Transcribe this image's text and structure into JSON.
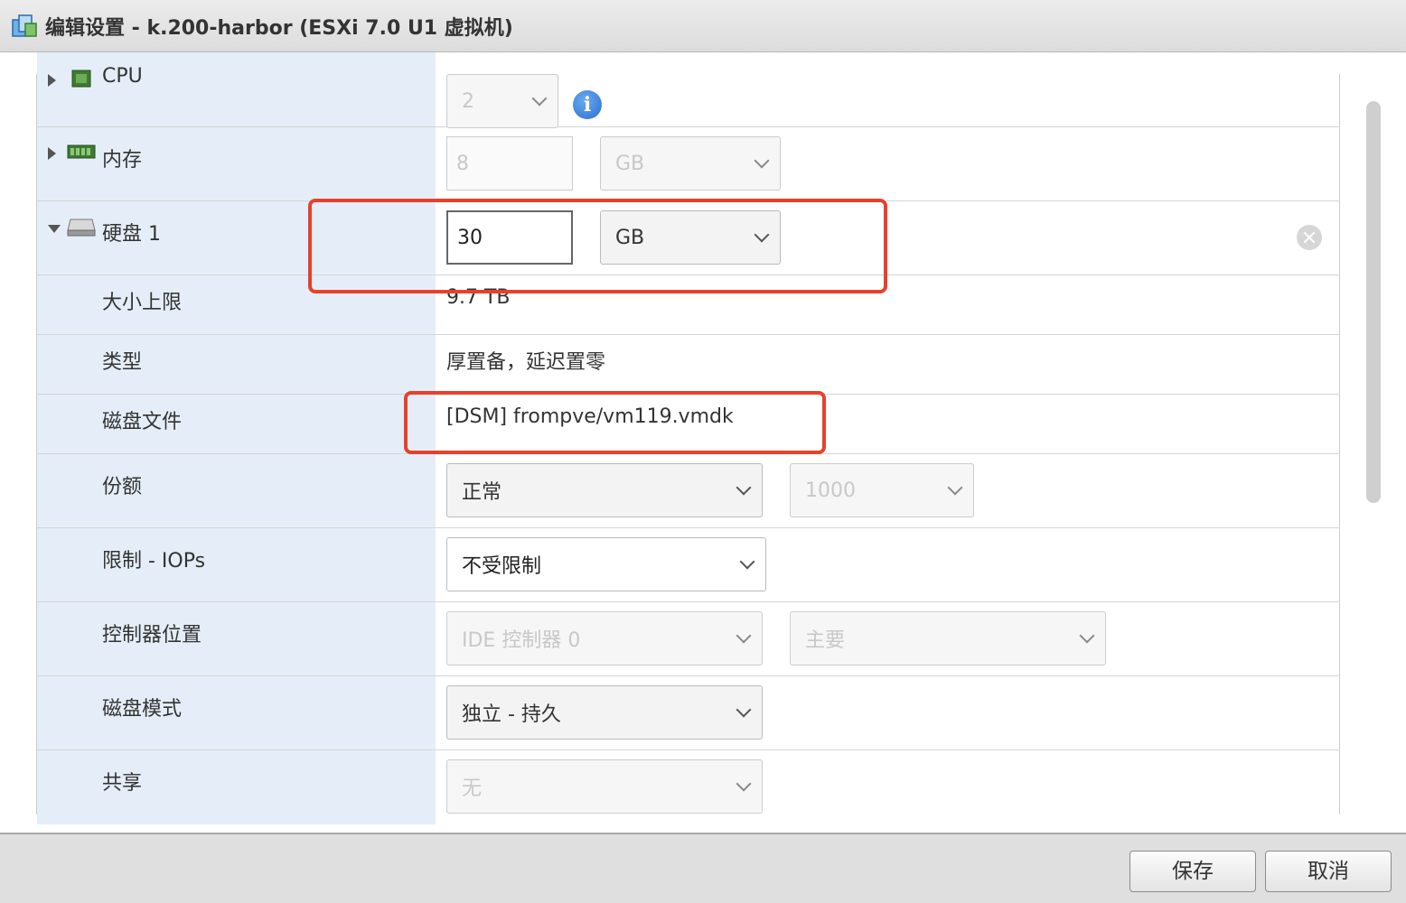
{
  "window": {
    "title": "编辑设置 - k.200-harbor (ESXi 7.0 U1 虚拟机)"
  },
  "rows": {
    "cpu": {
      "label": "CPU",
      "value": "2"
    },
    "memory": {
      "label": "内存",
      "value": "8",
      "unit": "GB"
    },
    "disk": {
      "label": "硬盘 1",
      "value": "30",
      "unit": "GB"
    },
    "max_size": {
      "label": "大小上限",
      "value": "9.7 TB"
    },
    "type": {
      "label": "类型",
      "value": "厚置备，延迟置零"
    },
    "disk_file": {
      "label": "磁盘文件",
      "value": "[DSM] frompve/vm119.vmdk"
    },
    "shares": {
      "label": "份额",
      "value": "正常",
      "amount": "1000"
    },
    "iops": {
      "label": "限制 - IOPs",
      "value": "不受限制"
    },
    "controller": {
      "label": "控制器位置",
      "value": "IDE 控制器 0",
      "position": "主要"
    },
    "mode": {
      "label": "磁盘模式",
      "value": "独立 - 持久"
    },
    "sharing": {
      "label": "共享",
      "value": "无"
    }
  },
  "icons": {
    "info": "i"
  },
  "footer": {
    "save": "保存",
    "cancel": "取消"
  },
  "colors": {
    "highlight": "#e8402b",
    "label_bg": "#e5eef8"
  }
}
